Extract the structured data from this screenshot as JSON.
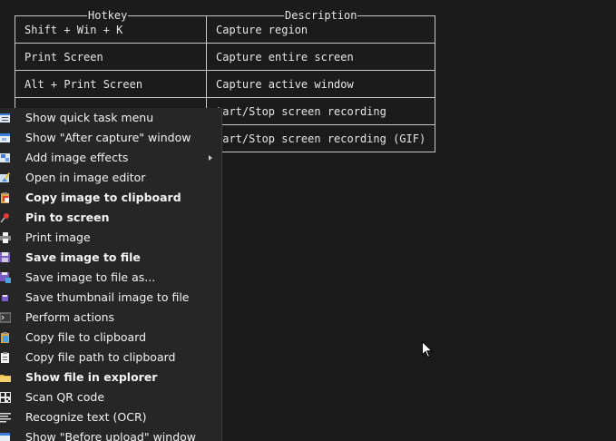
{
  "hotkey_table": {
    "headers": [
      "Hotkey",
      "Description"
    ],
    "rows": [
      {
        "hotkey": "Shift + Win + K",
        "description": "Capture region"
      },
      {
        "hotkey": "Print Screen",
        "description": "Capture entire screen"
      },
      {
        "hotkey": "Alt + Print Screen",
        "description": "Capture active window"
      },
      {
        "hotkey": "",
        "description": "tart/Stop screen recording"
      },
      {
        "hotkey": "",
        "description": "tart/Stop screen recording (GIF)"
      }
    ]
  },
  "context_menu": {
    "items": [
      {
        "label": "Show quick task menu",
        "icon": "task-menu-icon",
        "bold": false
      },
      {
        "label": "Show \"After capture\" window",
        "icon": "window-icon",
        "bold": false
      },
      {
        "label": "Add image effects",
        "icon": "image-effects-icon",
        "bold": false,
        "submenu": true
      },
      {
        "label": "Open in image editor",
        "icon": "image-editor-icon",
        "bold": false
      },
      {
        "label": "Copy image to clipboard",
        "icon": "clipboard-image-icon",
        "bold": true
      },
      {
        "label": "Pin to screen",
        "icon": "pin-icon",
        "bold": true
      },
      {
        "label": "Print image",
        "icon": "printer-icon",
        "bold": false
      },
      {
        "label": "Save image to file",
        "icon": "save-icon",
        "bold": true
      },
      {
        "label": "Save image to file as...",
        "icon": "save-as-icon",
        "bold": false
      },
      {
        "label": "Save thumbnail image to file",
        "icon": "thumbnail-save-icon",
        "bold": false
      },
      {
        "label": "Perform actions",
        "icon": "terminal-icon",
        "bold": false
      },
      {
        "label": "Copy file to clipboard",
        "icon": "copy-file-icon",
        "bold": false
      },
      {
        "label": "Copy file path to clipboard",
        "icon": "copy-path-icon",
        "bold": false
      },
      {
        "label": "Show file in explorer",
        "icon": "folder-icon",
        "bold": true
      },
      {
        "label": "Scan QR code",
        "icon": "qr-code-icon",
        "bold": false
      },
      {
        "label": "Recognize text (OCR)",
        "icon": "ocr-icon",
        "bold": false
      },
      {
        "label": "Show \"Before upload\" window",
        "icon": "upload-window-icon",
        "bold": false
      }
    ]
  },
  "colors": {
    "background": "#1b1b1b",
    "menu_background": "#262626",
    "table_border": "#c8c8c8",
    "text": "#e8e8e8"
  }
}
